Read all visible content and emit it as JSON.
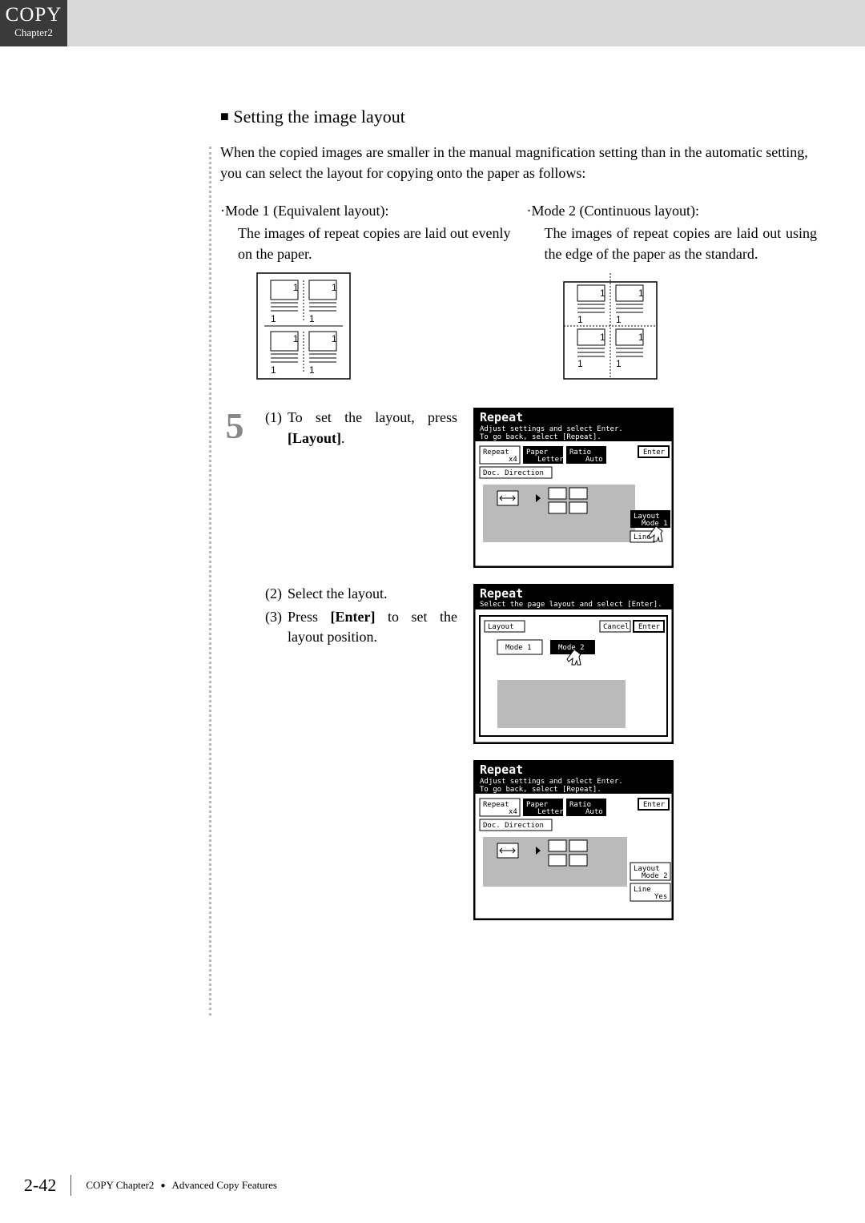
{
  "tab": {
    "title": "COPY",
    "subtitle": "Chapter2"
  },
  "heading": "Setting the image layout",
  "intro": "When the copied images are smaller in the manual magnification setting than in the automatic setting, you can select the layout for copying onto the paper as follows:",
  "mode1": {
    "head": "·Mode 1 (Equivalent layout):",
    "desc": "The images of repeat copies are laid out evenly on the paper."
  },
  "mode2": {
    "head": "·Mode 2 (Continuous layout):",
    "desc": "The images of repeat copies are laid out using the edge of the paper as the standard."
  },
  "step5": {
    "number": "5",
    "sub1": {
      "n": "(1)",
      "t": "To set the layout, press [Layout]."
    },
    "sub2": {
      "n": "(2)",
      "t": "Select the layout."
    },
    "sub3": {
      "n": "(3)",
      "t": "Press [Enter] to set the layout position."
    }
  },
  "screen1": {
    "title": "Repeat",
    "line1": "Adjust settings and select Enter.",
    "line2": "To go back, select [Repeat].",
    "repeat": "Repeat",
    "repeat_val": "x4",
    "paper": "Paper",
    "paper_val": "Letter",
    "ratio": "Ratio",
    "ratio_val": "Auto",
    "enter": "Enter",
    "docdir": "Doc. Direction",
    "layout": "Layout",
    "layout_val": "Mode 1",
    "line": "Line"
  },
  "screen2": {
    "title": "Repeat",
    "line1": "Select the page layout and select [Enter].",
    "layout": "Layout",
    "cancel": "Cancel",
    "enter": "Enter",
    "mode1": "Mode 1",
    "mode2": "Mode 2"
  },
  "screen3": {
    "title": "Repeat",
    "line1": "Adjust settings and select Enter.",
    "line2": "To go back, select [Repeat].",
    "repeat": "Repeat",
    "repeat_val": "x4",
    "paper": "Paper",
    "paper_val": "Letter",
    "ratio": "Ratio",
    "ratio_val": "Auto",
    "enter": "Enter",
    "docdir": "Doc. Direction",
    "layout": "Layout",
    "layout_val": "Mode 2",
    "line": "Line",
    "line_val": "Yes"
  },
  "footer": {
    "page": "2-42",
    "chapter": "COPY Chapter2",
    "section": "Advanced Copy Features"
  }
}
